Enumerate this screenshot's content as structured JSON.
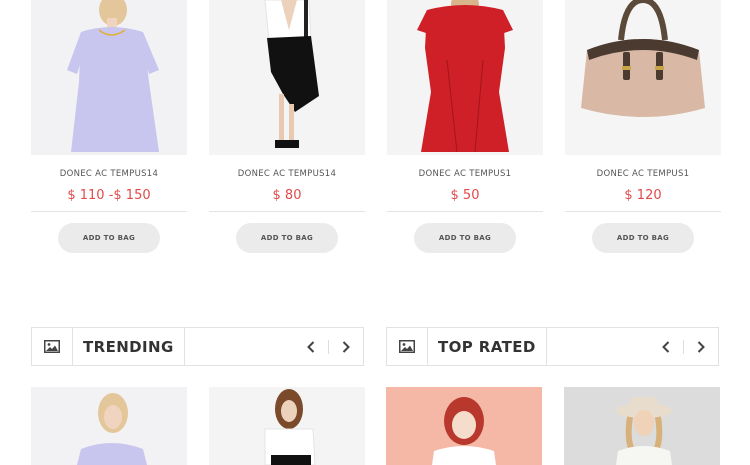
{
  "products": [
    {
      "name": "DONEC AC TEMPUS14",
      "price": "$ 110 -$ 150",
      "bag_label": "ADD TO BAG",
      "image": "lavender-dress-model"
    },
    {
      "name": "DONEC AC TEMPUS14",
      "price": "$ 80",
      "bag_label": "ADD TO BAG",
      "image": "white-blouse-black-skirt-model"
    },
    {
      "name": "DONEC AC TEMPUS1",
      "price": "$ 50",
      "bag_label": "ADD TO BAG",
      "image": "red-dress-model"
    },
    {
      "name": "DONEC AC TEMPUS1",
      "price": "$ 120",
      "bag_label": "ADD TO BAG",
      "image": "beige-handbag"
    }
  ],
  "sections": {
    "trending": {
      "title": "TRENDING",
      "icon": "image-icon"
    },
    "top_rated": {
      "title": "TOP RATED",
      "icon": "image-icon"
    }
  },
  "colors": {
    "price": "#e24a4a",
    "button_bg": "#ebebeb",
    "border": "#e2e2e2"
  }
}
